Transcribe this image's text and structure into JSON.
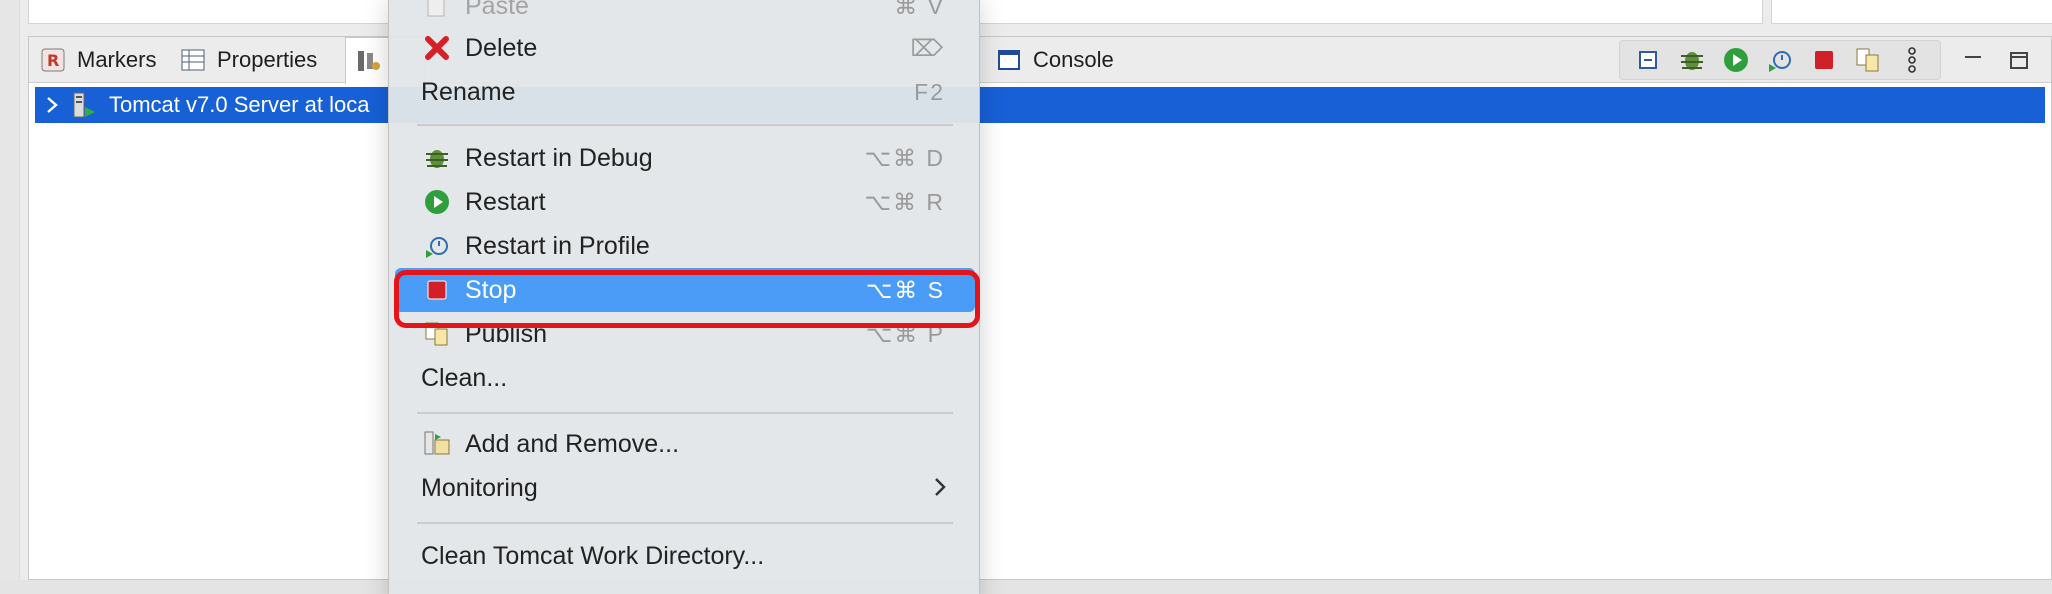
{
  "tabs": [
    {
      "label": "Markers",
      "icon": "markers-icon"
    },
    {
      "label": "Properties",
      "icon": "properties-icon"
    },
    {
      "label": "",
      "icon": "servers-icon"
    },
    {
      "label": "Console",
      "icon": "console-icon"
    }
  ],
  "server_row": {
    "label": "Tomcat v7.0 Server at loca"
  },
  "menu": {
    "paste": {
      "label": "Paste",
      "shortcut": "⌘ V"
    },
    "delete": {
      "label": "Delete",
      "shortcut": "⌦"
    },
    "rename": {
      "label": "Rename",
      "shortcut": "F2"
    },
    "restart_debug": {
      "label": "Restart in Debug",
      "shortcut": "⌥⌘ D"
    },
    "restart": {
      "label": "Restart",
      "shortcut": "⌥⌘ R"
    },
    "restart_profile": {
      "label": "Restart in Profile",
      "shortcut": ""
    },
    "stop": {
      "label": "Stop",
      "shortcut": "⌥⌘ S"
    },
    "publish": {
      "label": "Publish",
      "shortcut": "⌥⌘ P"
    },
    "clean": {
      "label": "Clean...",
      "shortcut": ""
    },
    "add_remove": {
      "label": "Add and Remove...",
      "shortcut": ""
    },
    "monitoring": {
      "label": "Monitoring",
      "shortcut": ""
    },
    "clean_tomcat": {
      "label": "Clean Tomcat Work Directory...",
      "shortcut": ""
    }
  },
  "colors": {
    "selection_blue": "#1760d6",
    "menu_highlight": "#4a9cf7",
    "annotation_red": "#e3151b"
  }
}
